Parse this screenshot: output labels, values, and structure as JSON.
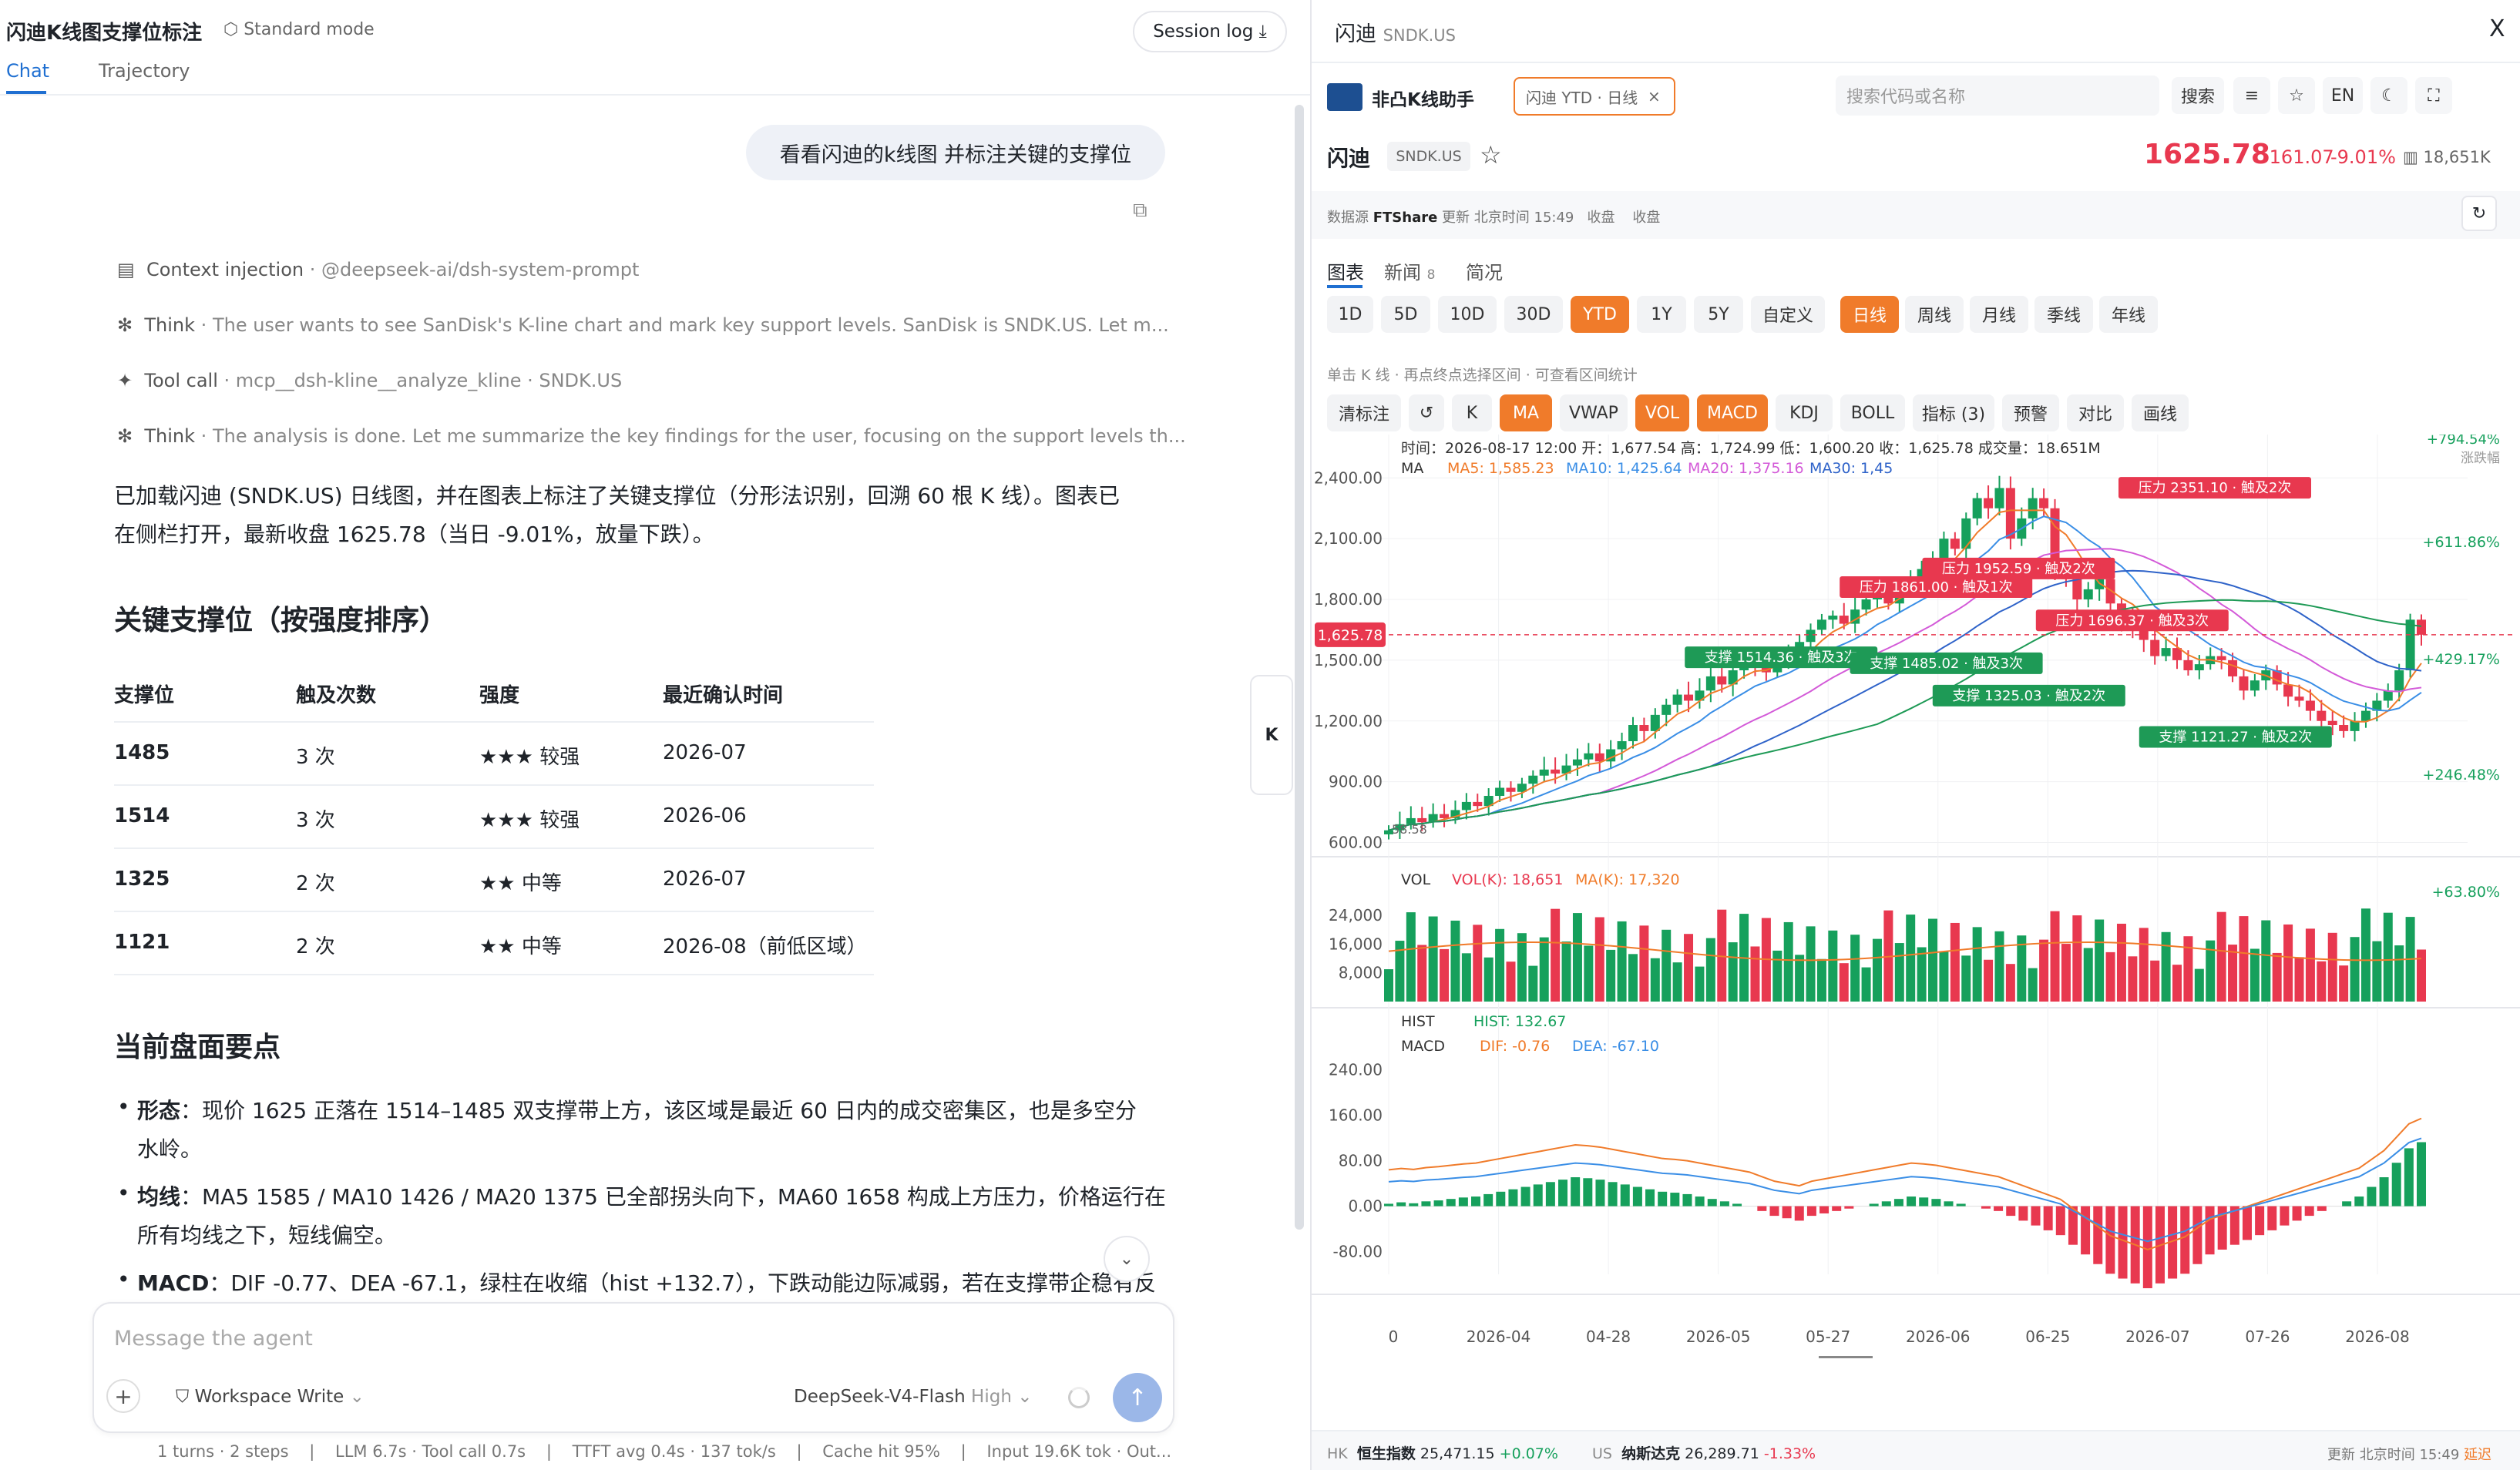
{
  "header": {
    "title": "闪迪K线图支撑位标注",
    "mode": "Standard mode",
    "session_log": "Session log"
  },
  "tabs": [
    "Chat",
    "Trajectory"
  ],
  "user_msg": "看看闪迪的k线图 并标注关键的支撑位",
  "steps": [
    {
      "kind": "Context injection",
      "detail": "@deepseek-ai/dsh-system-prompt"
    },
    {
      "kind": "Think",
      "detail": "The user wants to see SanDisk's K-line chart and mark key support levels. SanDisk is SNDK.US. Let m..."
    },
    {
      "kind": "Tool call",
      "detail": "mcp__dsh-kline__analyze_kline · SNDK.US"
    },
    {
      "kind": "Think",
      "detail": "The analysis is done. Let me summarize the key findings for the user, focusing on the support levels th..."
    }
  ],
  "answer": {
    "intro1": "已加载闪迪 (SNDK.US) 日线图，并在图表上标注了关键支撑位（分形法识别，回溯 60 根 K 线）。图表已",
    "intro2": "在侧栏打开，最新收盘 1625.78（当日 -9.01%，放量下跌）。",
    "h2a": "关键支撑位（按强度排序）",
    "table_headers": [
      "支撑位",
      "触及次数",
      "强度",
      "最近确认时间"
    ],
    "table_rows": [
      [
        "1485",
        "3 次",
        "★★★ 较强",
        "2026-07"
      ],
      [
        "1514",
        "3 次",
        "★★★ 较强",
        "2026-06"
      ],
      [
        "1325",
        "2 次",
        "★★ 中等",
        "2026-07"
      ],
      [
        "1121",
        "2 次",
        "★★ 中等",
        "2026-08（前低区域）"
      ]
    ],
    "h2b": "当前盘面要点",
    "bullets": [
      {
        "label": "形态",
        "text1": "：现价 1625 正落在 1514–1485 双支撑带上方，该区域是最近 60 日内的成交密集区，也是多空分",
        "text2": "水岭。"
      },
      {
        "label": "均线",
        "text1": "：MA5 1585 / MA10 1426 / MA20 1375 已全部拐头向下，MA60 1658 构成上方压力，价格运行在",
        "text2": "所有均线之下，短线偏空。"
      },
      {
        "label": "MACD",
        "text1": "：DIF -0.77、DEA -67.1，绿柱在收缩（hist +132.7），下跌动能边际减弱，若在支撑带企稳有反",
        "text2": ""
      }
    ]
  },
  "composer": {
    "placeholder": "Message the agent",
    "workspace": "Workspace Write",
    "model": "DeepSeek-V4-Flash",
    "effort": "High"
  },
  "footer_stats": "1 turns · 2 steps    |    LLM 6.7s · Tool call 0.7s    |    TTFT avg 0.4s · 137 tok/s    |    Cache hit 95%    |    Input 19.6K tok · Out...",
  "side_handle": "K",
  "panel": {
    "title": "闪迪",
    "ticker": "SNDK.US",
    "close": "X",
    "app_name": "非凸K线助手",
    "tab_label": "闪迪 YTD · 日线",
    "search_placeholder": "搜索代码或名称",
    "search_btn": "搜索",
    "lang": "EN",
    "stock_name": "闪迪",
    "stock_code": "SNDK.US",
    "price": "1625.78",
    "change": "-161.07",
    "change_pct": "-9.01%",
    "volume": "18,651K",
    "source_line1": "数据源 ",
    "source_brand": "FTShare",
    "source_line2": " 更新 北京时间 15:49   收盘    收盘",
    "subtabs": [
      "图表",
      "新闻",
      "简况"
    ],
    "news_count": "8",
    "periods": [
      "1D",
      "5D",
      "10D",
      "30D",
      "YTD",
      "1Y",
      "5Y",
      "自定义"
    ],
    "intervals": [
      "日线",
      "周线",
      "月线",
      "季线",
      "年线"
    ],
    "hint": "单击 K 线 · 再点终点选择区间 · 可查看区间统计",
    "tools": [
      "清标注",
      "↺",
      "K",
      "MA",
      "VWAP",
      "VOL",
      "MACD",
      "KDJ",
      "BOLL",
      "指标 (3)",
      "预警",
      "对比",
      "画线"
    ],
    "ohlc": "时间：2026-08-17 12:00    开：1,677.54    高：1,724.99    低：1,600.20    收：1,625.78    成交量：18.651M",
    "ma_label": "MA",
    "ma5": "MA5: 1,585.23",
    "ma10": "MA10: 1,425.64",
    "ma20": "MA20: 1,375.16",
    "ma30": "MA30: 1,45",
    "y_price": [
      "2,400.00",
      "2,100.00",
      "1,800.00",
      "1,500.00",
      "1,200.00",
      "900.00",
      "600.00"
    ],
    "pct_right": [
      "+794.54%",
      "+611.86%",
      "+429.17%",
      "+246.48%"
    ],
    "pct_top_label": "涨跌幅",
    "price_tag": "1,625.78",
    "min_label": "58.58",
    "annotations": [
      {
        "text": "压力 2351.10 · 触及2次",
        "type": "res"
      },
      {
        "text": "压力 1861.00 · 触及1次",
        "type": "res"
      },
      {
        "text": "压力 1952.59 · 触及2次",
        "type": "res"
      },
      {
        "text": "压力 1696.37 · 触及3次",
        "type": "res"
      },
      {
        "text": "支撑 1514.36 · 触及3次",
        "type": "sup"
      },
      {
        "text": "支撑 1485.02 · 触及3次",
        "type": "sup"
      },
      {
        "text": "支撑 1325.03 · 触及2次",
        "type": "sup"
      },
      {
        "text": "支撑 1121.27 · 触及2次",
        "type": "sup"
      }
    ],
    "vol_label": "VOL",
    "vol_k": "VOL(K): 18,651",
    "vol_ma": "MA(K): 17,320",
    "vol_y": [
      "24,000",
      "16,000",
      "8,000"
    ],
    "vol_pct": "+63.80%",
    "hist_label": "HIST",
    "hist_val": "HIST: 132.67",
    "macd_label": "MACD",
    "dif": "DIF: -0.76",
    "dea": "DEA: -67.10",
    "macd_y": [
      "240.00",
      "160.00",
      "80.00",
      "0.00",
      "-80.00"
    ],
    "x_labels": [
      "0",
      "2026-04",
      "04-28",
      "2026-05",
      "05-27",
      "2026-06",
      "06-25",
      "2026-07",
      "07-26",
      "2026-08"
    ],
    "ticker_bar": {
      "hk": "HK",
      "hk_name": "恒生指数",
      "hk_val": "25,471.15",
      "hk_chg": "+0.07%",
      "us": "US",
      "us_name": "纳斯达克",
      "us_val": "26,289.71",
      "us_chg": "-1.33%",
      "update": "更新 北京时间 15:49",
      "delay": "延迟"
    }
  },
  "colors": {
    "up": "#e8384f",
    "down": "#16a05c",
    "accent": "#f07b2a",
    "blue": "#1f6fd1",
    "ma5": "#f07b2a",
    "ma10": "#3a8ee6",
    "ma20": "#d35ad8",
    "ma30": "#2f63c9",
    "ma60": "#1e9a56"
  },
  "chart_data": {
    "type": "candlestick",
    "title": "闪迪 YTD · 日线",
    "y_range": [
      600,
      2500
    ],
    "last_close": 1625.78,
    "closes": [
      660,
      690,
      720,
      700,
      740,
      720,
      760,
      800,
      780,
      830,
      870,
      850,
      890,
      930,
      960,
      940,
      980,
      1010,
      1040,
      1000,
      1060,
      1100,
      1180,
      1150,
      1230,
      1280,
      1330,
      1300,
      1350,
      1420,
      1380,
      1450,
      1500,
      1480,
      1440,
      1500,
      1540,
      1590,
      1650,
      1700,
      1720,
      1680,
      1750,
      1800,
      1830,
      1780,
      1860,
      1900,
      1950,
      2000,
      2100,
      2050,
      2200,
      2300,
      2250,
      2350,
      2100,
      2200,
      2300,
      2250,
      1950,
      1900,
      1800,
      1850,
      1900,
      1780,
      1700,
      1650,
      1600,
      1520,
      1560,
      1500,
      1450,
      1480,
      1520,
      1500,
      1420,
      1350,
      1400,
      1450,
      1380,
      1320,
      1300,
      1250,
      1200,
      1180,
      1150,
      1200,
      1250,
      1300,
      1350,
      1450,
      1700,
      1625.78
    ],
    "macd_hist": [
      5,
      8,
      6,
      10,
      12,
      15,
      18,
      20,
      25,
      30,
      35,
      40,
      45,
      50,
      55,
      60,
      58,
      55,
      50,
      45,
      40,
      35,
      30,
      28,
      25,
      20,
      15,
      10,
      5,
      0,
      -10,
      -20,
      -25,
      -30,
      -20,
      -15,
      -10,
      -5,
      0,
      5,
      10,
      15,
      20,
      18,
      15,
      10,
      5,
      0,
      -5,
      -10,
      -20,
      -30,
      -40,
      -50,
      -60,
      -80,
      -100,
      -120,
      -140,
      -150,
      -160,
      -170,
      -160,
      -150,
      -140,
      -120,
      -100,
      -90,
      -80,
      -70,
      -60,
      -50,
      -40,
      -30,
      -20,
      -10,
      0,
      10,
      20,
      40,
      60,
      90,
      120,
      132.67
    ],
    "annotations": [
      {
        "type": "resistance",
        "price": 2351.1,
        "touches": 2
      },
      {
        "type": "resistance",
        "price": 1861.0,
        "touches": 1
      },
      {
        "type": "resistance",
        "price": 1952.59,
        "touches": 2
      },
      {
        "type": "resistance",
        "price": 1696.37,
        "touches": 3
      },
      {
        "type": "support",
        "price": 1514.36,
        "touches": 3
      },
      {
        "type": "support",
        "price": 1485.02,
        "touches": 3
      },
      {
        "type": "support",
        "price": 1325.03,
        "touches": 2
      },
      {
        "type": "support",
        "price": 1121.27,
        "touches": 2
      }
    ]
  }
}
